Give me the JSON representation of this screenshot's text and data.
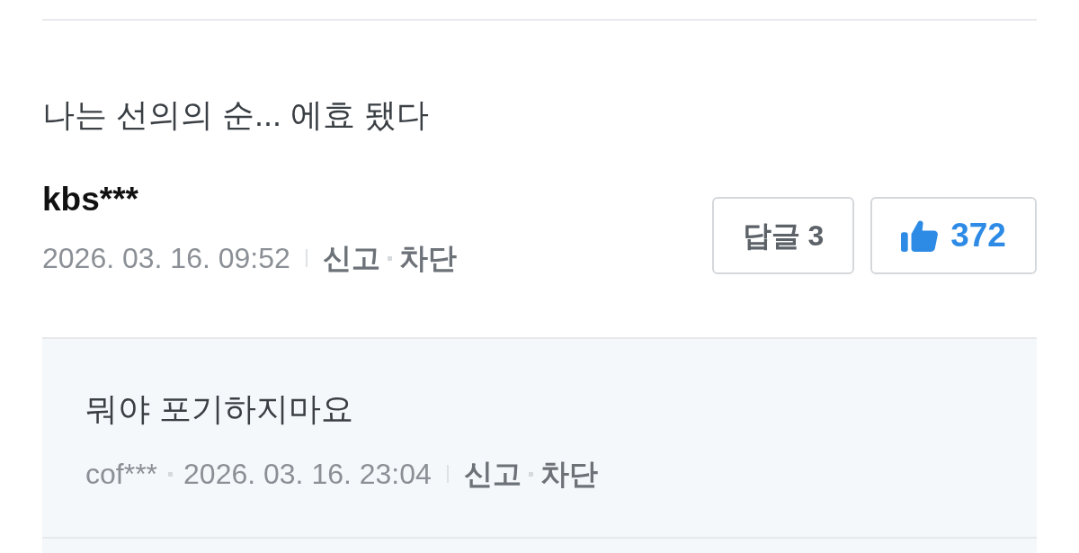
{
  "comment": {
    "text": "나는 선의의 순... 에효 됐다",
    "author": "kbs***",
    "date": "2026. 03. 16. 09:52",
    "actions": [
      "신고",
      "차단"
    ],
    "reply_button": {
      "label": "답글 3"
    },
    "like_button": {
      "count": "372"
    }
  },
  "replies": [
    {
      "text": "뭐야 포기하지마요",
      "author": "cof***",
      "date": "2026. 03. 16. 23:04",
      "actions": [
        "신고",
        "차단"
      ]
    }
  ]
}
